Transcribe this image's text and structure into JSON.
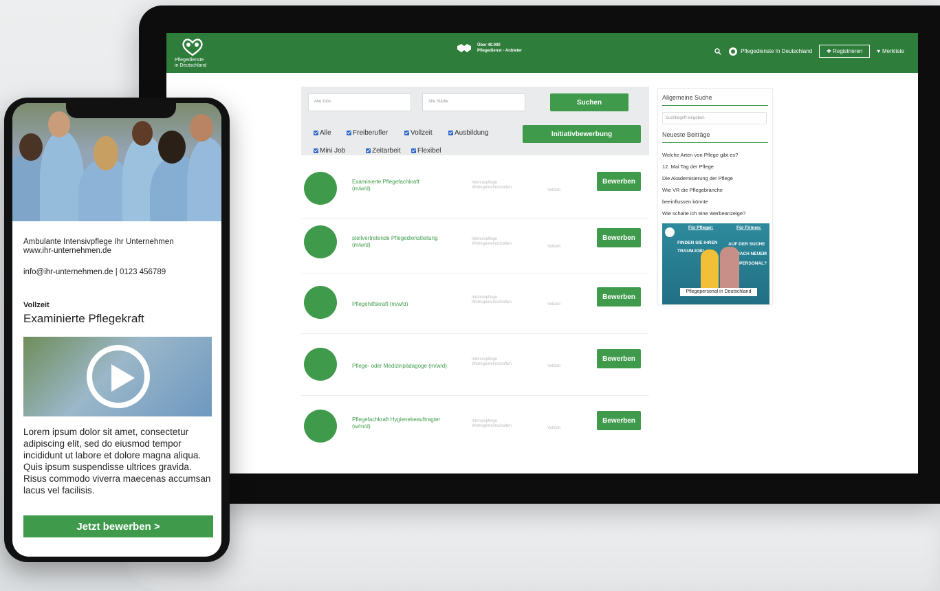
{
  "desktop": {
    "header": {
      "logo_line1": "Pflegedienste",
      "logo_line2": "in Deutschland",
      "center_line1": "Über 40.000",
      "center_line2": "Pflegedienst - Anbieter",
      "brand": "Pflegedienste In Deutschland",
      "register_label": "Registrieren",
      "watchlist_label": "Merkliste",
      "accent": "#2e7d3b"
    },
    "search": {
      "jobs_placeholder": "Alle Jobs",
      "cities_placeholder": "Alle Städte",
      "search_button": "Suchen",
      "initiative_button": "Initiativbewerbung",
      "filters_row1": [
        "Alle",
        "Freiberufler",
        "Vollzeit",
        "Ausbildung"
      ],
      "filters_row2": [
        "Mini Job",
        "Zeitarbeit",
        "Flexibel"
      ]
    },
    "jobs": [
      {
        "title1": "Examinierte Pflegefachkraft",
        "title2": "(m/w/d)",
        "cat1": "Intensivpflege",
        "cat2": "Wohngemeinschaften",
        "type": "Vollzeit",
        "button": "Bewerben"
      },
      {
        "title1": "stellvertretende Pflegedienstleitung",
        "title2": "(m/w/d)",
        "cat1": "Intensivpflege",
        "cat2": "Wohngemeinschaften",
        "type": "Vollzeit",
        "button": "Bewerben"
      },
      {
        "title1": "Pflegehilfskraft (m/w/d)",
        "title2": "",
        "cat1": "Intensivpflege",
        "cat2": "Wohngemeinschaften",
        "type": "Vollzeit",
        "button": "Bewerben"
      },
      {
        "title1": "Pflege- oder Medizinpädagoge (m/w/d)",
        "title2": "",
        "cat1": "Intensivpflege",
        "cat2": "Wohngemeinschaften",
        "type": "Vollzeit",
        "button": "Bewerben"
      },
      {
        "title1": "Pflegefachkraft Hygienebeauftragter",
        "title2": "(w/m/d)",
        "cat1": "Intensivpflege",
        "cat2": "Wohngemeinschaften",
        "type": "Vollzeit",
        "button": "Bewerben"
      }
    ],
    "sidebar": {
      "general_search": "Allgemeine Suche",
      "search_placeholder": "Suchbegriff eingeben",
      "latest_posts": "Neueste Beiträge",
      "posts": [
        "Welche Arten von Pflege gibt es?",
        "12. Mai Tag der Pflege",
        "Die Akademisierung der Pflege",
        "Wie VR die Pflegebranche",
        "beeinflussen könnte",
        "Wie schalte ich eine Werbeanzeige?"
      ],
      "ad": {
        "for_carers": "Für Pfleger:",
        "for_companies": "Für Firmen:",
        "left_text1": "FINDEN SIE IHREN",
        "left_text2": "TRAUMJOB!",
        "right_text1": "AUF DER SUCHE",
        "right_text2": "NACH NEUEM",
        "right_text3": "PERSONAL?",
        "bottom": "Pflegepersonal in Deutschland"
      }
    }
  },
  "mobile": {
    "company_line1": "Ambulante Intensivpflege Ihr Unternehmen",
    "company_line2": "www.ihr-unternehmen.de",
    "contact": "info@ihr-unternehmen.de  |  0123 456789",
    "job_type": "Vollzeit",
    "job_title": "Examinierte Pflegekraft",
    "description": "Lorem ipsum dolor sit amet, consectetur adipiscing elit, sed do eiusmod tempor incididunt ut labore et dolore magna aliqua. Quis ipsum suspendisse ultrices gravida. Risus commodo viverra maecenas accumsan lacus vel facilisis.",
    "apply_button": "Jetzt bewerben >"
  }
}
